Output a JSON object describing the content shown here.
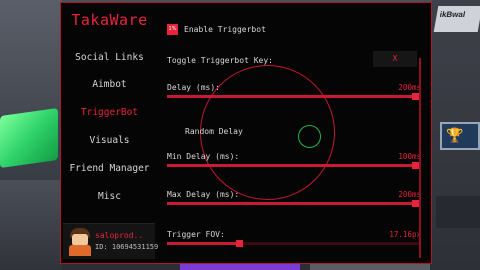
{
  "app": {
    "title": "TakaWare"
  },
  "sidebar": {
    "items": [
      {
        "label": "Social Links"
      },
      {
        "label": "Aimbot"
      },
      {
        "label": "TriggerBot"
      },
      {
        "label": "Visuals"
      },
      {
        "label": "Friend Manager"
      },
      {
        "label": "Misc"
      }
    ],
    "active_index": 2
  },
  "user": {
    "name": "saloprod..",
    "id_text": "ID: 10694531159"
  },
  "triggerbot": {
    "enable_label": "Enable Triggerbot",
    "enable_checked": true,
    "toggle_key_label": "Toggle Triggerbot Key:",
    "toggle_key_value": "X",
    "delay_label": "Delay (ms):",
    "delay_value": "200ms",
    "delay_fill": 1.0,
    "random_delay_label": "Random Delay",
    "min_delay_label": "Min Delay (ms):",
    "min_delay_value": "100ms",
    "min_delay_fill": 1.0,
    "max_delay_label": "Max Delay (ms):",
    "max_delay_value": "200ms",
    "max_delay_fill": 1.0,
    "fov_label": "Trigger FOV:",
    "fov_value": "17.16px",
    "fov_fill": 0.28
  },
  "background": {
    "sign_text": "ikBwal"
  },
  "colors": {
    "accent": "#e8243c",
    "border": "#b5132a",
    "panel_bg": "#050505",
    "random_indicator": "#23b64a"
  }
}
